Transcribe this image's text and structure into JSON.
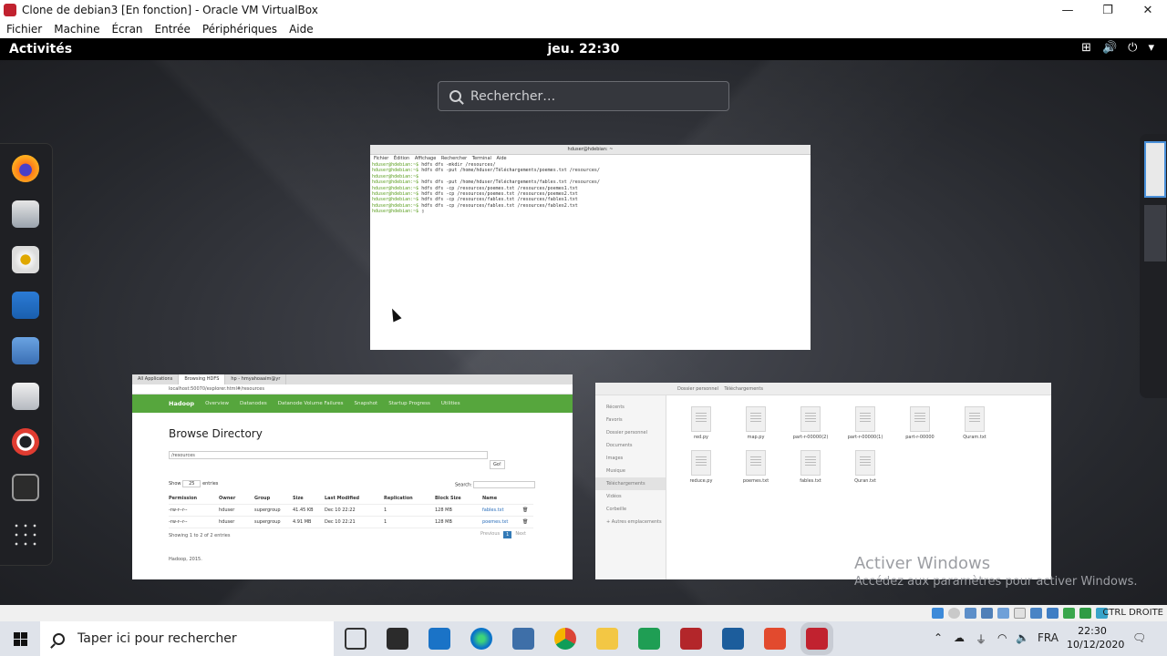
{
  "vbox": {
    "title": "Clone de debian3 [En fonction] - Oracle VM VirtualBox",
    "menu": [
      "Fichier",
      "Machine",
      "Écran",
      "Entrée",
      "Périphériques",
      "Aide"
    ],
    "host_key": "CTRL DROITE",
    "window_controls": [
      "minimize-icon",
      "restore-icon",
      "close-icon"
    ]
  },
  "gnome": {
    "activities": "Activités",
    "clock": "jeu. 22:30",
    "search_placeholder": "Rechercher…",
    "dash_apps": [
      "firefox-icon",
      "evolution-icon",
      "rhythmbox-icon",
      "writer-icon",
      "files-icon",
      "software-icon",
      "help-icon",
      "terminal-icon",
      "show-apps-icon"
    ]
  },
  "terminal": {
    "title": "hduser@hdebian: ~",
    "menu": "Fichier Édition Affichage Rechercher Terminal Aide",
    "lines": [
      {
        "prompt": "hduser@hdebian:~$",
        "cmd": " hdfs dfs -mkdir /resources/"
      },
      {
        "prompt": "hduser@hdebian:~$",
        "cmd": " hdfs dfs -put /home/hduser/Téléchargements/poemes.txt /resources/"
      },
      {
        "prompt": "",
        "cmd": ""
      },
      {
        "prompt": "",
        "cmd": ""
      },
      {
        "prompt": "hduser@hdebian:~$",
        "cmd": ""
      },
      {
        "prompt": "hduser@hdebian:~$",
        "cmd": " hdfs dfs -put /home/hduser/Téléchargements/fables.txt /resources/"
      },
      {
        "prompt": "hduser@hdebian:~$",
        "cmd": " hdfs dfs -cp /resources/poemes.txt /resources/poemes1.txt"
      },
      {
        "prompt": "hduser@hdebian:~$",
        "cmd": " hdfs dfs -cp /resources/poemes.txt /resources/poemes2.txt"
      },
      {
        "prompt": "hduser@hdebian:~$",
        "cmd": " hdfs dfs -cp /resources/fables.txt /resources/fables1.txt"
      },
      {
        "prompt": "hduser@hdebian:~$",
        "cmd": " hdfs dfs -cp /resources/fables.txt /resources/fables2.txt"
      },
      {
        "prompt": "hduser@hdebian:~$",
        "cmd": " ▯"
      }
    ]
  },
  "browser": {
    "tabs": [
      "All Applications",
      "Browsing HDFS",
      "hp - hmyahoaaim@yr"
    ],
    "url": "localhost:50070/explorer.html#/resources",
    "nav": [
      "Hadoop",
      "Overview",
      "Datanodes",
      "Datanode Volume Failures",
      "Snapshot",
      "Startup Progress",
      "Utilities"
    ],
    "heading": "Browse Directory",
    "path": "/resources",
    "go": "Go!",
    "show": "Show",
    "show_value": "25",
    "entries": "entries",
    "search": "Search:",
    "columns": [
      "Permission",
      "Owner",
      "Group",
      "Size",
      "Last Modified",
      "Replication",
      "Block Size",
      "Name"
    ],
    "rows": [
      [
        "-rw-r--r--",
        "hduser",
        "supergroup",
        "41.45 KB",
        "Dec 10 22:22",
        "1",
        "128 MB",
        "fables.txt"
      ],
      [
        "-rw-r--r--",
        "hduser",
        "supergroup",
        "4.91 MB",
        "Dec 10 22:21",
        "1",
        "128 MB",
        "poemes.txt"
      ]
    ],
    "showing": "Showing 1 to 2 of 2 entries",
    "previous": "Previous",
    "page": "1",
    "next": "Next",
    "footer": "Hadoop, 2015."
  },
  "files": {
    "breadcrumb": [
      "Dossier personnel",
      "Téléchargements"
    ],
    "sidebar": [
      "Récents",
      "Favoris",
      "Dossier personnel",
      "Documents",
      "Images",
      "Musique",
      "Téléchargements",
      "Vidéos",
      "Corbeille",
      "+ Autres emplacements"
    ],
    "items": [
      "red.py",
      "map.py",
      "part-r-00000(2)",
      "part-r-00000(1)",
      "part-r-00000",
      "Quram.txt",
      "reduce.py",
      "poemes.txt",
      "fables.txt",
      "Quran.txt"
    ]
  },
  "watermark": {
    "line1": "Activer Windows",
    "line2": "Accédez aux paramètres pour activer Windows."
  },
  "taskbar": {
    "search_placeholder": "Taper ici pour rechercher",
    "lang": "FRA",
    "time": "22:30",
    "date": "10/12/2020",
    "apps": [
      "task-view-icon",
      "store-icon",
      "mail-icon",
      "edge-icon",
      "virtualbox-manager-icon",
      "chrome-icon",
      "file-explorer-icon",
      "camtasia-icon",
      "filezilla-icon",
      "photos-icon",
      "app-icon",
      "virtualbox-vm-icon"
    ]
  }
}
